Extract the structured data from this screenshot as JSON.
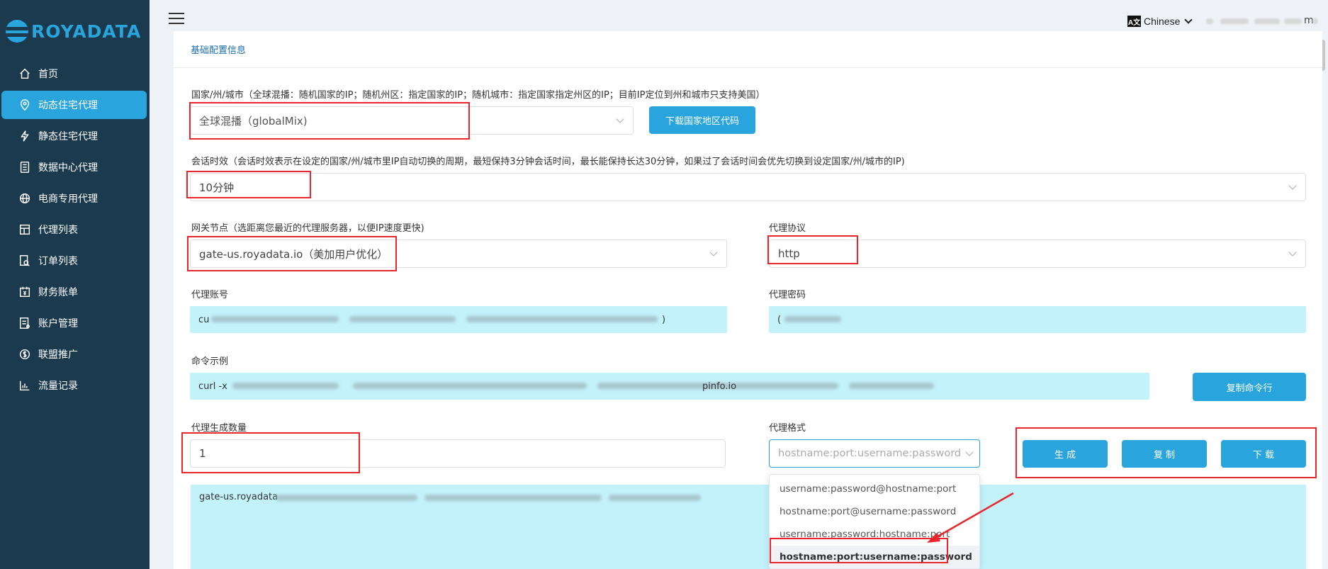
{
  "brand": {
    "name": "ROYADATA"
  },
  "sidebar": {
    "items": [
      {
        "label": "首页",
        "icon": "home-icon",
        "active": false
      },
      {
        "label": "动态住宅代理",
        "icon": "location-pin-icon",
        "active": true
      },
      {
        "label": "静态住宅代理",
        "icon": "lightning-icon",
        "active": false
      },
      {
        "label": "数据中心代理",
        "icon": "server-icon",
        "active": false
      },
      {
        "label": "电商专用代理",
        "icon": "globe-icon",
        "active": false
      },
      {
        "label": "代理列表",
        "icon": "list-icon",
        "active": false
      },
      {
        "label": "订单列表",
        "icon": "order-search-icon",
        "active": false
      },
      {
        "label": "财务账单",
        "icon": "bill-icon",
        "active": false
      },
      {
        "label": "账户管理",
        "icon": "account-icon",
        "active": false
      },
      {
        "label": "联盟推广",
        "icon": "dollar-icon",
        "active": false
      },
      {
        "label": "流量记录",
        "icon": "bar-chart-icon",
        "active": false
      }
    ]
  },
  "header": {
    "language": "Chinese",
    "user_visible": "m"
  },
  "card": {
    "title": "基础配置信息"
  },
  "form": {
    "country_label": "国家/州/城市（全球混播：随机国家的IP；随机州区：指定国家的IP；随机城市：指定国家指定州区的IP；目前IP定位到州和城市只支持美国）",
    "country_value": "全球混播（globalMix)",
    "download_code_button": "下载国家地区代码",
    "session_label": "会话时效（会话时效表示在设定的国家/州/城市里IP自动切换的周期，最短保持3分钟会话时间，最长能保持长达30分钟，如果过了会话时间会优先切换到设定国家/州/城市的IP)",
    "session_value": "10分钟",
    "gateway_label": "网关节点（选距离您最近的代理服务器，以便IP速度更快)",
    "gateway_value": "gate-us.royadata.io（美加用户优化）",
    "protocol_label": "代理协议",
    "protocol_value": "http",
    "account_label": "代理账号",
    "account_value_visible": "cu",
    "account_value_tail": ")",
    "password_label": "代理密码",
    "password_value_visible": "(",
    "command_label": "命令示例",
    "command_prefix": "curl -x",
    "command_suffix": "pinfo.io",
    "copy_command_button": "复制命令行",
    "quantity_label": "代理生成数量",
    "quantity_value": "1",
    "format_label": "代理格式",
    "format_placeholder": "hostname:port:username:password",
    "generate_button": "生 成",
    "copy_button": "复 制",
    "download_button": "下 载",
    "result_prefix": "gate-us.royadata"
  },
  "format_options": [
    {
      "label": "username:password@hostname:port",
      "selected": false
    },
    {
      "label": "hostname:port@username:password",
      "selected": false
    },
    {
      "label": "username:password:hostname:port",
      "selected": false
    },
    {
      "label": "hostname:port:username:password",
      "selected": true
    }
  ],
  "colors": {
    "sidebar_bg": "#1b3a4e",
    "accent": "#2aa4dc",
    "highlight_red": "#e8262b",
    "filled_field": "#c3f2fb"
  }
}
